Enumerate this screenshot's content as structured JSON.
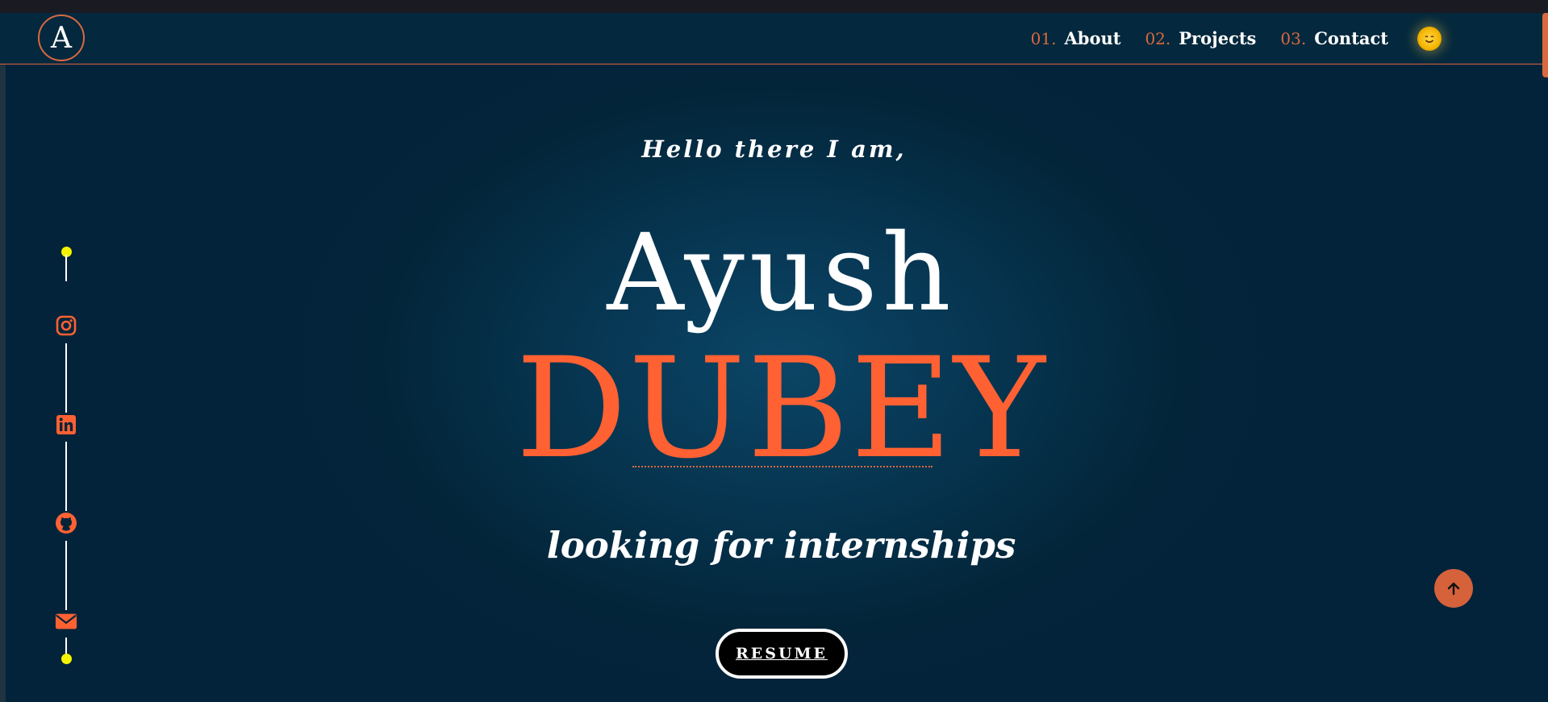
{
  "logo": {
    "letter": "A"
  },
  "nav": {
    "items": [
      {
        "num": "01.",
        "label": "About"
      },
      {
        "num": "02.",
        "label": "Projects"
      },
      {
        "num": "03.",
        "label": "Contact"
      }
    ],
    "theme_icon": "smiling-sun-icon"
  },
  "hero": {
    "greeting": "Hello there I am,",
    "first_name": "Ayush",
    "last_name": "DUBEY",
    "tagline": "looking for internships",
    "resume_label": "RESUME"
  },
  "social": {
    "icons": [
      "instagram-icon",
      "linkedin-icon",
      "github-icon",
      "mail-icon"
    ]
  },
  "colors": {
    "accent": "#ff6133",
    "background": "#032437",
    "rail_dot": "#f4f400"
  }
}
